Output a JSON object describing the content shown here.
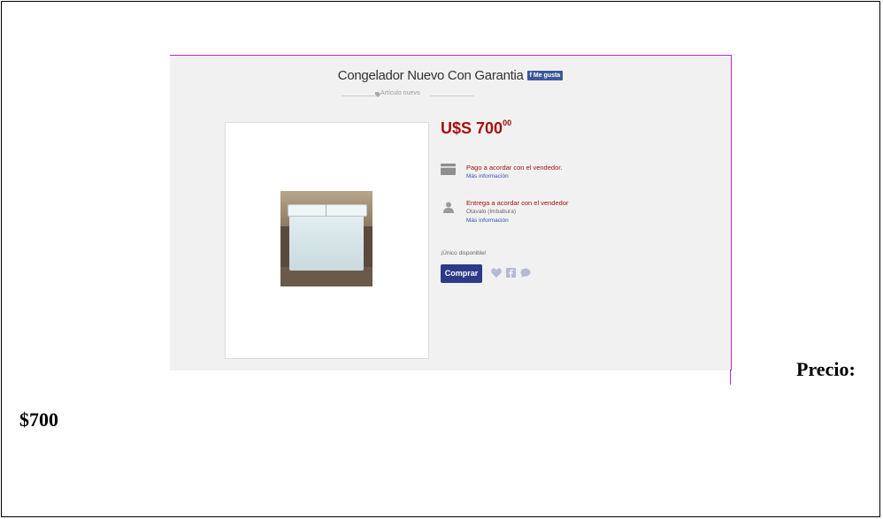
{
  "listing": {
    "title": "Congelador Nuevo Con Garantia",
    "fb_like_label": "Me gusta",
    "condition": "Artículo nuevo",
    "price_main": "U$S 700",
    "price_cents": "00",
    "payment": {
      "text": "Pago a acordar con el vendedor.",
      "link": "Más información"
    },
    "delivery": {
      "text": "Entrega a acordar con el vendedor",
      "location": "Otavalo (Imbabura)",
      "link": "Más información"
    },
    "availability": "¡Único disponible!",
    "buy_button": "Comprar",
    "colors": {
      "price": "#a31010",
      "button": "#2d3a8a",
      "link": "#2a56b8",
      "border": "#c228c2"
    },
    "social_icons": [
      "heart-icon",
      "facebook-icon",
      "comment-icon"
    ]
  },
  "document": {
    "price_label": "Precio:",
    "price_value": "$700"
  }
}
